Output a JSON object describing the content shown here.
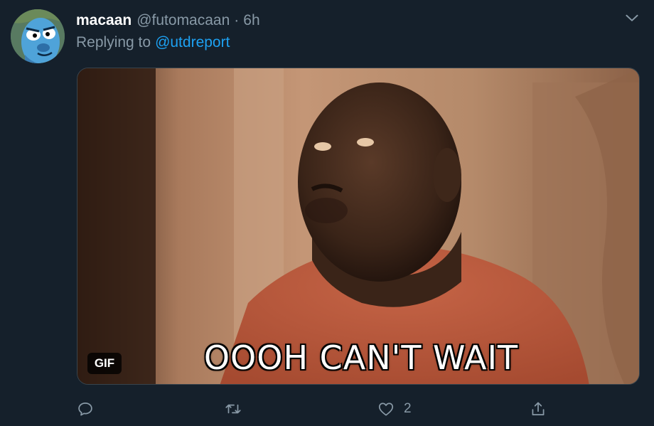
{
  "tweet": {
    "display_name": "macaan",
    "handle": "@futomacaan",
    "separator": "·",
    "time": "6h",
    "replying_prefix": "Replying to",
    "replying_to": "@utdreport",
    "media": {
      "badge": "GIF",
      "caption": "OOOH CAN'T WAIT"
    },
    "actions": {
      "reply_count": "",
      "retweet_count": "",
      "like_count": "2"
    }
  },
  "colors": {
    "background": "#15202b",
    "secondary_text": "#8899a6",
    "link": "#1da1f2",
    "border": "#38444d"
  },
  "icons": {
    "menu": "chevron-down-icon",
    "reply": "reply-icon",
    "retweet": "retweet-icon",
    "like": "heart-icon",
    "share": "share-icon"
  }
}
